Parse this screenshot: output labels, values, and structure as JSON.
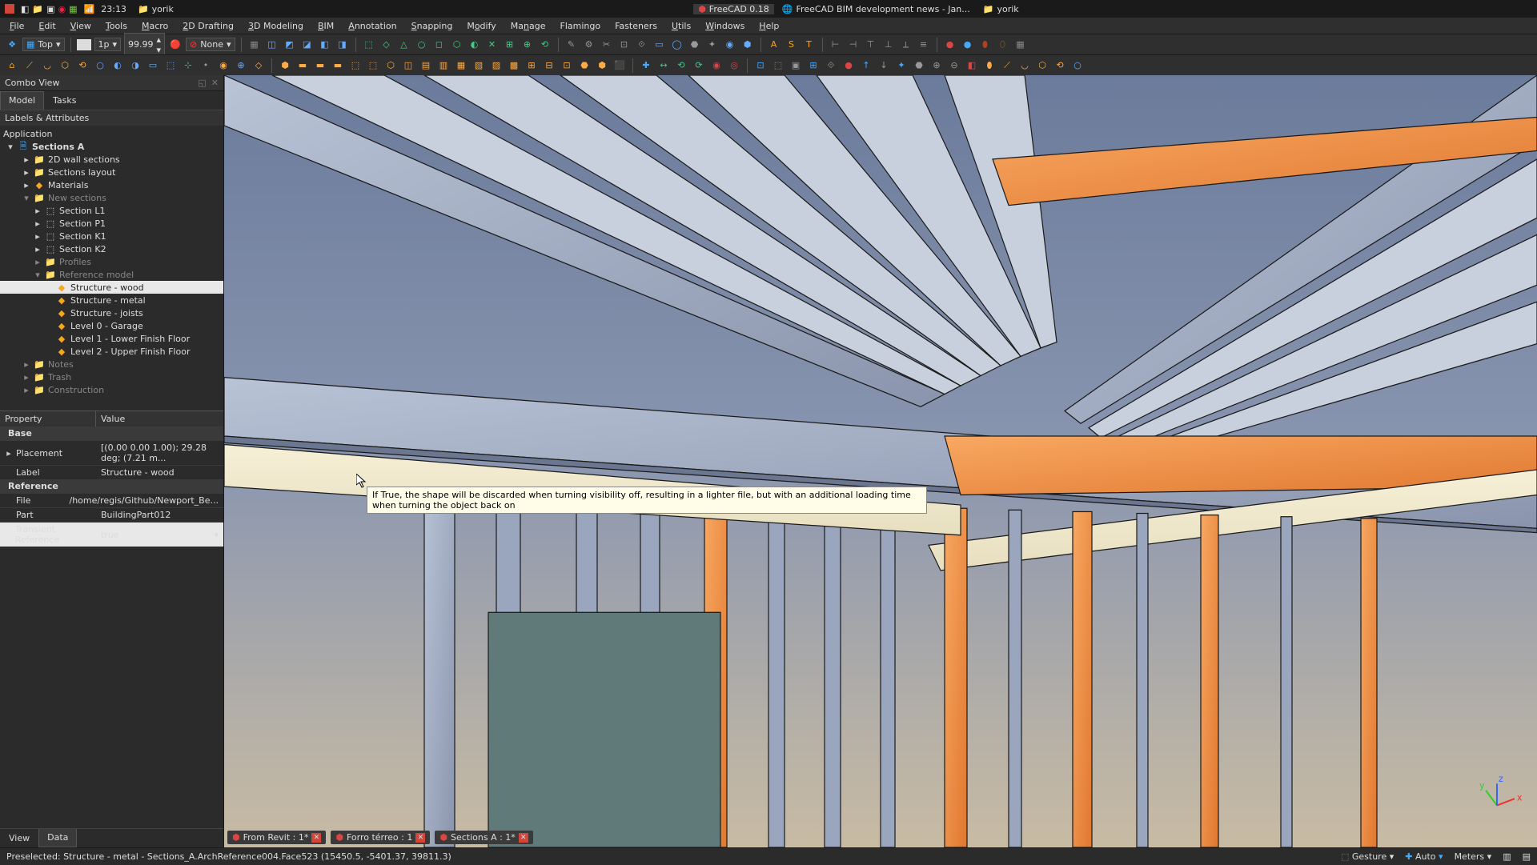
{
  "taskbar": {
    "time": "23:13",
    "user": "yorik",
    "windows": [
      {
        "title": "FreeCAD 0.18",
        "active": true
      },
      {
        "title": "FreeCAD BIM development news - Jan...",
        "active": false
      },
      {
        "title": "yorik",
        "active": false
      }
    ]
  },
  "menu": [
    "File",
    "Edit",
    "View",
    "Tools",
    "Macro",
    "2D Drafting",
    "3D Modeling",
    "BIM",
    "Annotation",
    "Snapping",
    "Modify",
    "Manage",
    "Flamingo",
    "Fasteners",
    "Utils",
    "Windows",
    "Help"
  ],
  "toolbar1": {
    "view_label": "Top",
    "lineweight": "1p",
    "zoom": "99.99",
    "construction": "None"
  },
  "panel": {
    "title": "Combo View",
    "tabs": [
      "Model",
      "Tasks"
    ],
    "active_tab": 0,
    "tree_header": "Labels & Attributes",
    "root": "Application",
    "doc": "Sections A",
    "items": [
      {
        "indent": 2,
        "exp": "▸",
        "icon": "folder-blue",
        "label": "2D wall sections"
      },
      {
        "indent": 2,
        "exp": "▸",
        "icon": "folder-blue",
        "label": "Sections layout"
      },
      {
        "indent": 2,
        "exp": "▸",
        "icon": "materials",
        "label": "Materials"
      },
      {
        "indent": 2,
        "exp": "▾",
        "icon": "folder",
        "label": "New sections",
        "dim": true
      },
      {
        "indent": 3,
        "exp": "▸",
        "icon": "section",
        "label": "Section L1"
      },
      {
        "indent": 3,
        "exp": "▸",
        "icon": "section",
        "label": "Section P1"
      },
      {
        "indent": 3,
        "exp": "▸",
        "icon": "section",
        "label": "Section K1"
      },
      {
        "indent": 3,
        "exp": "▸",
        "icon": "section",
        "label": "Section K2"
      },
      {
        "indent": 3,
        "exp": "▸",
        "icon": "folder",
        "label": "Profiles",
        "dim": true
      },
      {
        "indent": 3,
        "exp": "▾",
        "icon": "folder",
        "label": "Reference model",
        "dim": true
      },
      {
        "indent": 4,
        "exp": "",
        "icon": "ref",
        "label": "Structure - wood",
        "selected": true
      },
      {
        "indent": 4,
        "exp": "",
        "icon": "ref",
        "label": "Structure - metal"
      },
      {
        "indent": 4,
        "exp": "",
        "icon": "ref",
        "label": "Structure - joists"
      },
      {
        "indent": 4,
        "exp": "",
        "icon": "ref",
        "label": "Level 0 - Garage"
      },
      {
        "indent": 4,
        "exp": "",
        "icon": "ref",
        "label": "Level 1 - Lower Finish Floor"
      },
      {
        "indent": 4,
        "exp": "",
        "icon": "ref",
        "label": "Level 2 - Upper Finish Floor"
      },
      {
        "indent": 2,
        "exp": "▸",
        "icon": "folder",
        "label": "Notes",
        "dim": true
      },
      {
        "indent": 2,
        "exp": "▸",
        "icon": "folder",
        "label": "Trash",
        "dim": true
      },
      {
        "indent": 2,
        "exp": "▸",
        "icon": "folder",
        "label": "Construction",
        "dim": true
      }
    ],
    "prop_headers": [
      "Property",
      "Value"
    ],
    "prop_sections": [
      {
        "name": "Base",
        "rows": [
          {
            "k": "Placement",
            "v": "[(0.00 0.00 1.00); 29.28 deg; (7.21 m...",
            "exp": true
          },
          {
            "k": "Label",
            "v": "Structure - wood"
          }
        ]
      },
      {
        "name": "Reference",
        "rows": [
          {
            "k": "File",
            "v": "/home/regis/Github/Newport_Be..."
          },
          {
            "k": "Part",
            "v": "BuildingPart012"
          },
          {
            "k": "Transient Reference",
            "v": "true",
            "selected": true,
            "dropdown": true
          }
        ]
      }
    ],
    "bottom_tabs": [
      "View",
      "Data"
    ],
    "bottom_active": 1
  },
  "tooltip": "If True, the shape will be discarded when turning visibility off, resulting in a lighter file, but with an additional loading time when turning the object back on",
  "doc_tabs": [
    {
      "label": "From Revit : 1*",
      "closeable": true
    },
    {
      "label": "Forro térreo : 1",
      "closeable": true
    },
    {
      "label": "Sections A : 1*",
      "closeable": true
    }
  ],
  "statusbar": {
    "preselect": "Preselected: Structure - metal - Sections_A.ArchReference004.Face523 (15450.5, -5401.37, 39811.3)",
    "nav_style": "Gesture",
    "snap": "Auto",
    "units": "Meters"
  },
  "toolbar_icons_2": [
    "grid",
    "axo1",
    "axo2",
    "axo3",
    "axo4",
    "axo5",
    "sel1",
    "sel2",
    "sel3",
    "sel4",
    "sel5",
    "sel6",
    "sel7",
    "sel8",
    "sel9",
    "sel10",
    "sel11",
    "tool1",
    "tool2",
    "tool3",
    "tool4",
    "tool5",
    "tool6",
    "tool7",
    "tool8",
    "tool9",
    "tool10",
    "tool11",
    "tool12",
    "text-a",
    "text-s",
    "text-t",
    "dim1",
    "dim2",
    "dim3",
    "dim4",
    "dim5",
    "dim6",
    "color1",
    "color2",
    "circle1",
    "circle2"
  ],
  "toolbar_icons_3": [
    "bim1",
    "bim2",
    "bim3",
    "bim4",
    "bim5",
    "bim6",
    "bim7",
    "bim8",
    "bim9",
    "bim10",
    "bim11",
    "bim12",
    "bim13",
    "bim14",
    "arch1",
    "arch2",
    "arch3",
    "arch4",
    "arch5",
    "arch6",
    "arch7",
    "arch8",
    "arch9",
    "arch10",
    "arch11",
    "arch12",
    "arch13",
    "arch14",
    "arch15",
    "arch16",
    "arch17",
    "arch18",
    "arch19",
    "arch20",
    "arch21",
    "arch22",
    "arch23",
    "arch24",
    "arch25",
    "arch26",
    "mod1",
    "mod2",
    "mod3",
    "mod4",
    "mod5",
    "mod6",
    "mod7",
    "mod8",
    "mod9",
    "mod10",
    "mod11",
    "mod12",
    "mod13",
    "mod14",
    "mod15",
    "mod16",
    "mod17",
    "mod18",
    "mod19"
  ]
}
